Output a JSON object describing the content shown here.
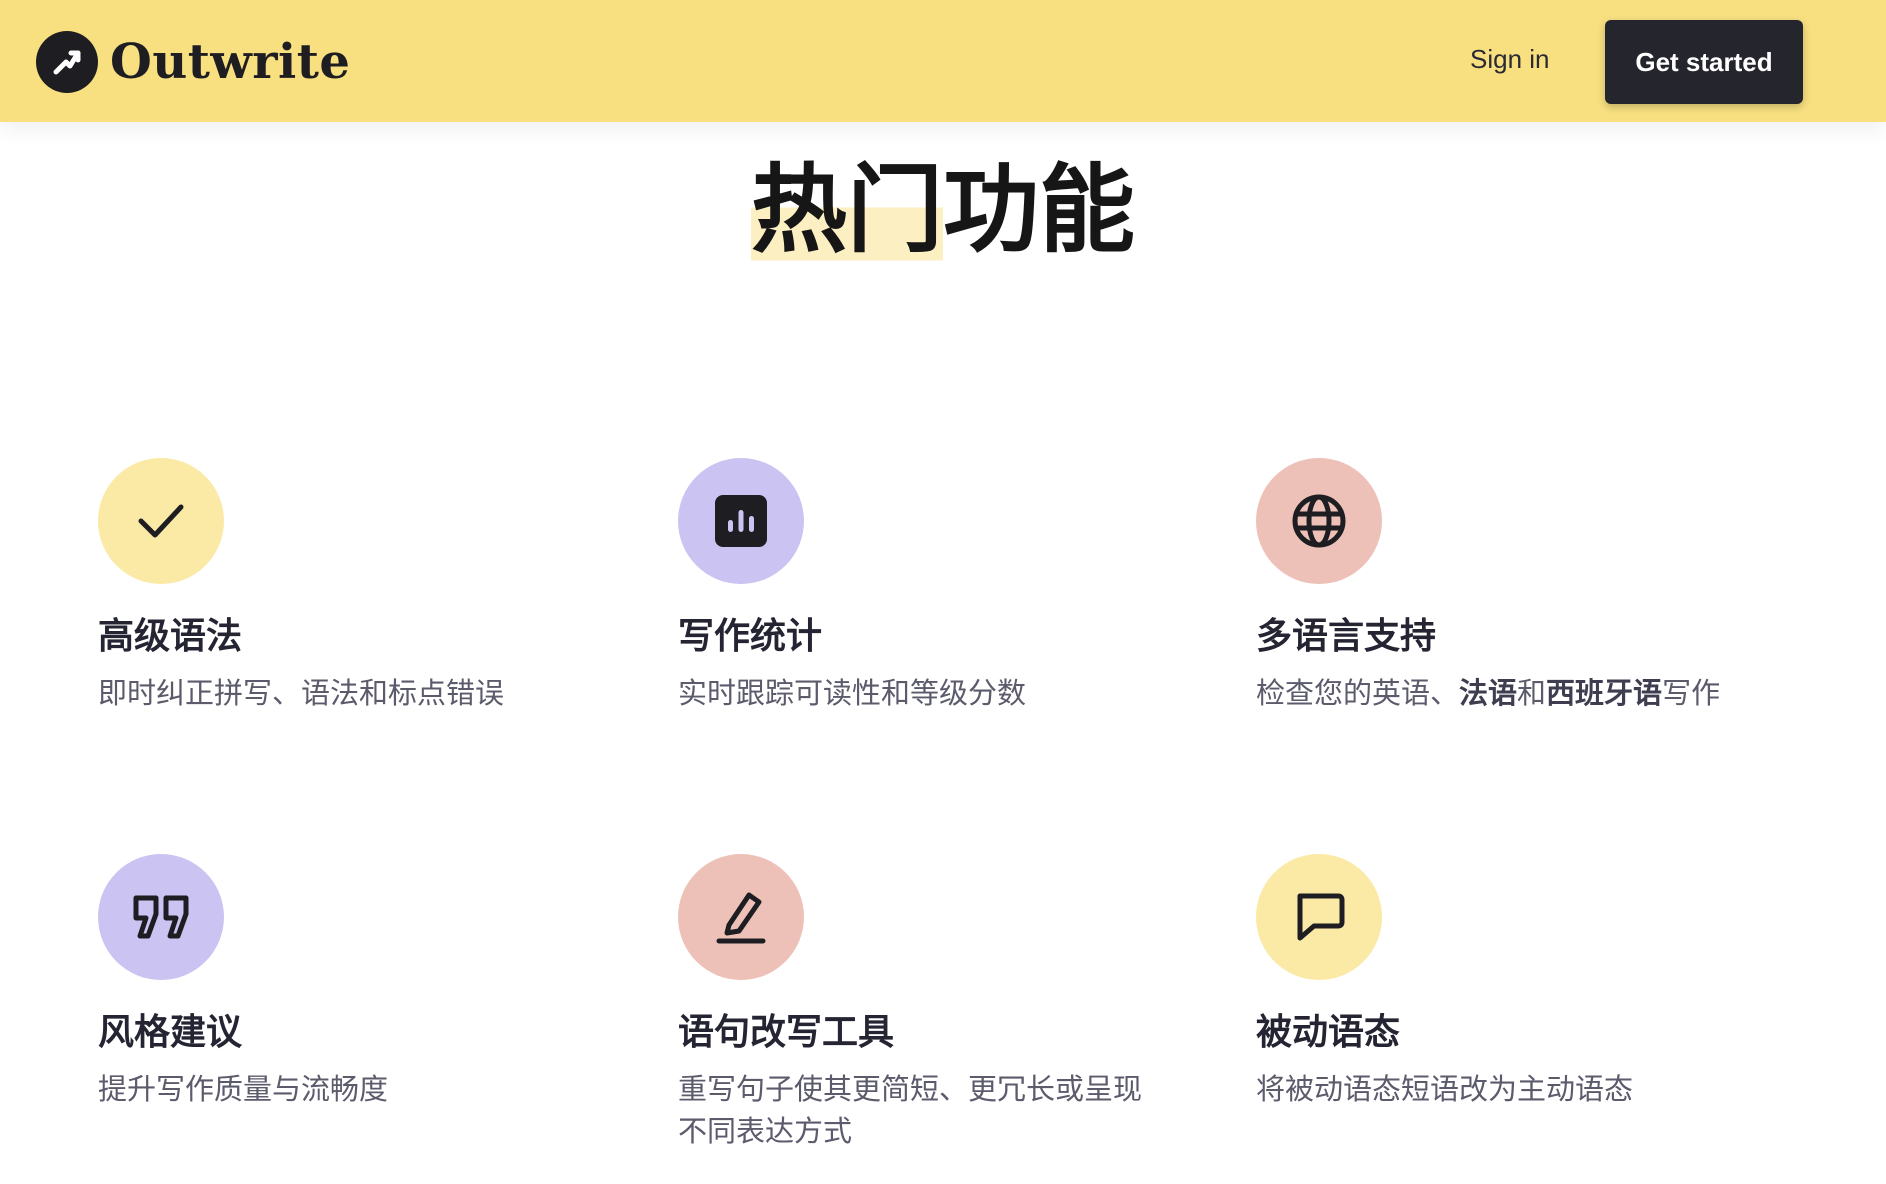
{
  "header": {
    "brand": "Outwrite",
    "sign_in_label": "Sign in",
    "cta_label": "Get started",
    "background_color": "#f8df80"
  },
  "section": {
    "title_highlighted": "热门",
    "title_rest": "功能"
  },
  "features": [
    {
      "title": "高级语法",
      "desc": "即时纠正拼写、语法和标点错误",
      "icon": "check-icon",
      "color": "#fbe9a6"
    },
    {
      "title": "写作统计",
      "desc": "实时跟踪可读性和等级分数",
      "icon": "bar-chart-icon",
      "color": "#cbc3f1"
    },
    {
      "title": "多语言支持",
      "desc_parts": [
        "检查您的英语、",
        "法语",
        "和",
        "西班牙语",
        "写作"
      ],
      "icon": "globe-icon",
      "color": "#eec1b8"
    },
    {
      "title": "风格建议",
      "desc": "提升写作质量与流畅度",
      "icon": "quote-icon",
      "color": "#cbc3f1"
    },
    {
      "title": "语句改写工具",
      "desc": "重写句子使其更简短、更冗长或呈现不同表达方式",
      "icon": "pen-icon",
      "color": "#eec1b8"
    },
    {
      "title": "被动语态",
      "desc": "将被动语态短语改为主动语态",
      "icon": "chat-bubble-icon",
      "color": "#fbe9a6"
    }
  ]
}
